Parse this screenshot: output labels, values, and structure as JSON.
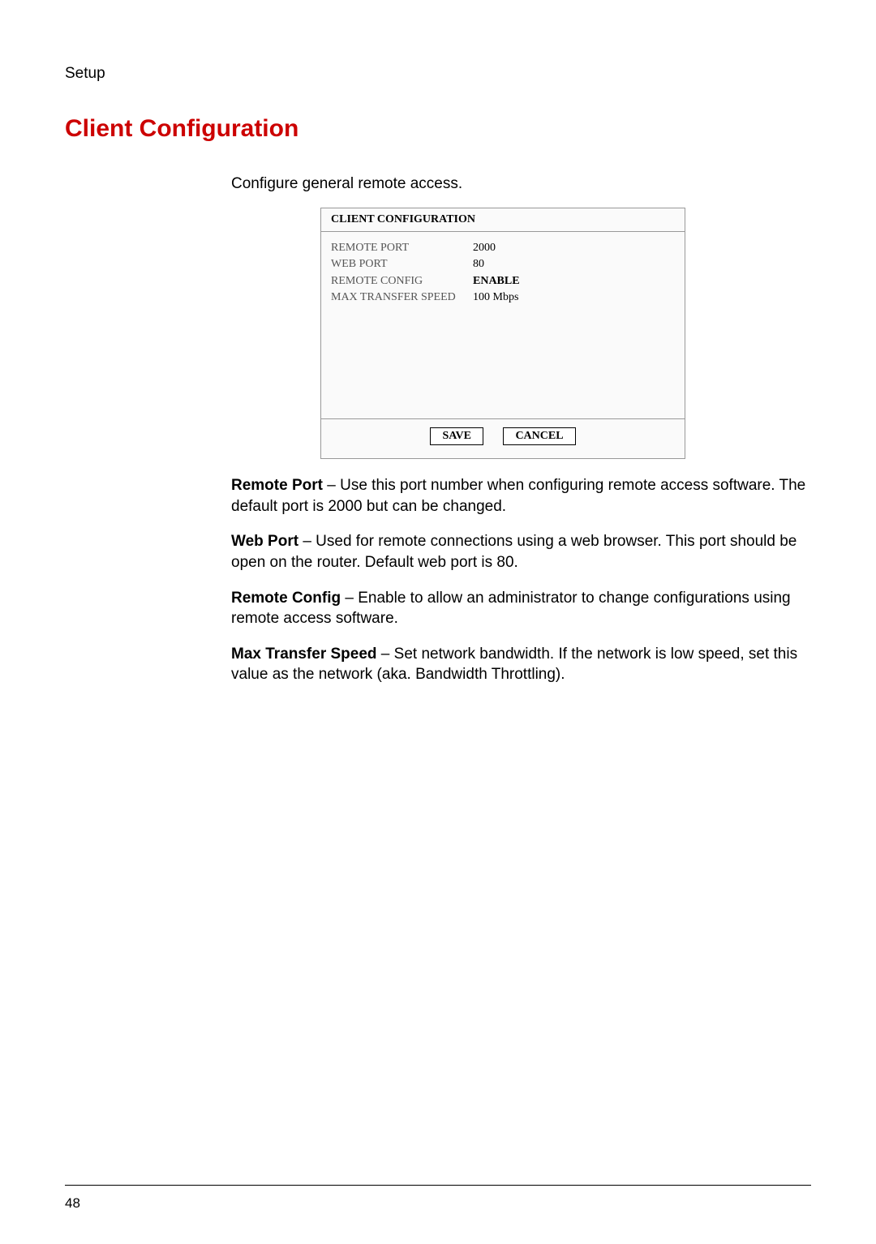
{
  "header": {
    "section": "Setup"
  },
  "title": "Client Configuration",
  "intro": "Configure general remote access.",
  "dialog": {
    "title": "CLIENT CONFIGURATION",
    "rows": [
      {
        "label": "REMOTE PORT",
        "value": "2000",
        "bold": false
      },
      {
        "label": "WEB PORT",
        "value": "80",
        "bold": false
      },
      {
        "label": "REMOTE CONFIG",
        "value": "ENABLE",
        "bold": true
      },
      {
        "label": "MAX TRANSFER SPEED",
        "value": "100 Mbps",
        "bold": false
      }
    ],
    "buttons": {
      "save": "SAVE",
      "cancel": "CANCEL"
    }
  },
  "definitions": [
    {
      "term": "Remote Port",
      "text": " – Use this port number when configuring remote access software. The default port is 2000 but can be changed."
    },
    {
      "term": "Web Port",
      "text": " – Used for remote connections using a web browser. This port should be open on the router. Default web port is 80."
    },
    {
      "term": "Remote Config",
      "text": " – Enable to allow an administrator to change configurations using remote access software."
    },
    {
      "term": "Max Transfer Speed",
      "text": " – Set network bandwidth. If the network is low speed, set this value as the network (aka. Bandwidth Throttling)."
    }
  ],
  "footer": {
    "page": "48"
  }
}
